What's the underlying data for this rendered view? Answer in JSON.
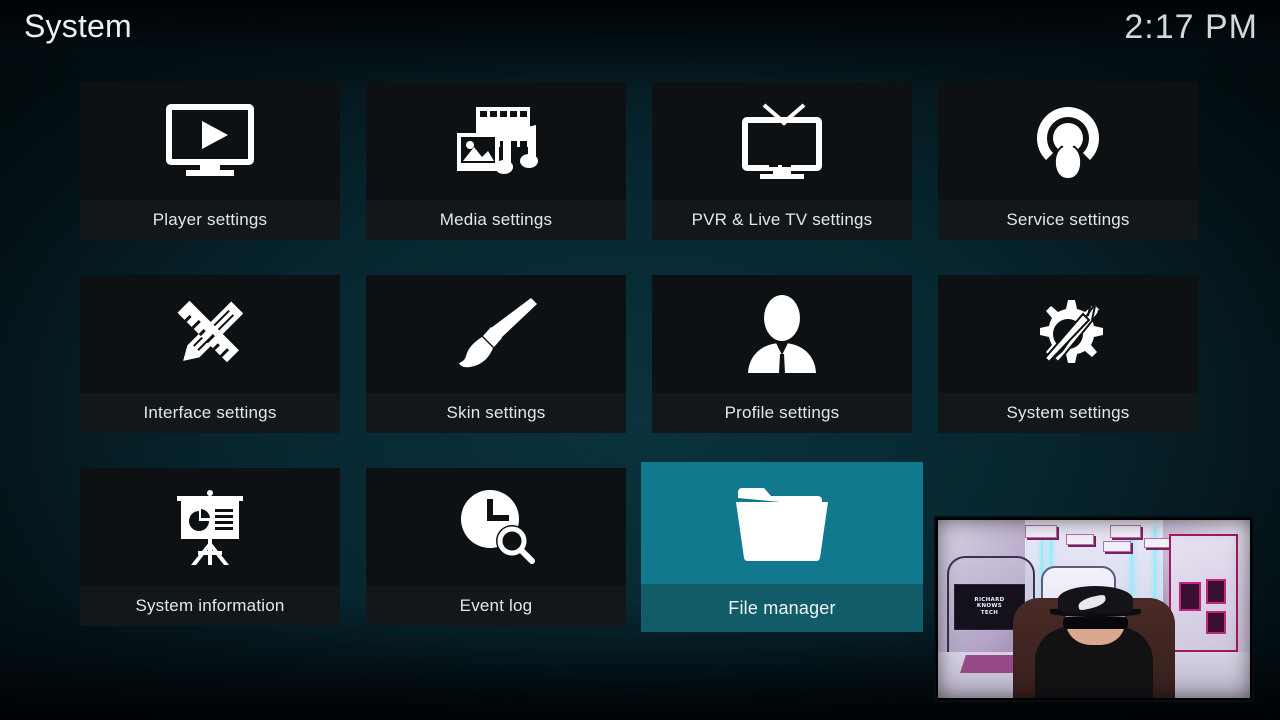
{
  "header": {
    "title": "System",
    "clock": "2:17 PM"
  },
  "theme": {
    "background_dark_teal": "#072630",
    "tile_background": "#0d1113",
    "tile_label_background": "#12171a",
    "selected_tile": "#11788e",
    "selected_label": "#115c68",
    "text": "#dfe9ec"
  },
  "grid": {
    "columns": 4,
    "rows": 3,
    "tiles": [
      {
        "label": "Player settings",
        "icon": "monitor-play-icon",
        "selected": false
      },
      {
        "label": "Media settings",
        "icon": "film-photo-music-icon",
        "selected": false
      },
      {
        "label": "PVR & Live TV settings",
        "icon": "tv-antenna-icon",
        "selected": false
      },
      {
        "label": "Service settings",
        "icon": "broadcast-person-icon",
        "selected": false
      },
      {
        "label": "Interface settings",
        "icon": "pencil-ruler-cross-icon",
        "selected": false
      },
      {
        "label": "Skin settings",
        "icon": "paintbrush-icon",
        "selected": false
      },
      {
        "label": "Profile settings",
        "icon": "user-silhouette-icon",
        "selected": false
      },
      {
        "label": "System settings",
        "icon": "gear-tools-icon",
        "selected": false
      },
      {
        "label": "System information",
        "icon": "presentation-chart-icon",
        "selected": false
      },
      {
        "label": "Event log",
        "icon": "clock-search-icon",
        "selected": false
      },
      {
        "label": "File manager",
        "icon": "folder-icon",
        "selected": true
      },
      {
        "label": "",
        "icon": "",
        "selected": false
      }
    ]
  },
  "webcam_overlay": {
    "present": true,
    "description": "live webcam picture-in-picture",
    "sign_lines": [
      "RICHARD",
      "KNOWS",
      "TECH"
    ]
  }
}
